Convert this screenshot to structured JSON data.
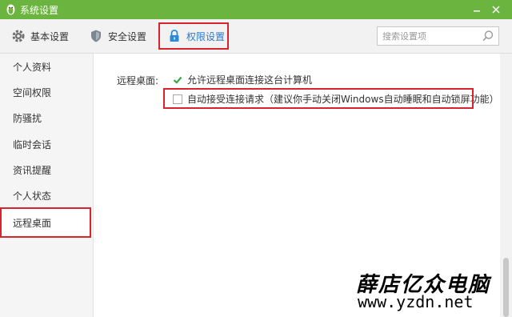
{
  "window": {
    "title": "系统设置",
    "accent_color": "#6ab43f"
  },
  "tabs": [
    {
      "label": "基本设置",
      "icon": "gear-icon"
    },
    {
      "label": "安全设置",
      "icon": "shield-icon"
    },
    {
      "label": "权限设置",
      "icon": "lock-icon",
      "selected": true
    }
  ],
  "search": {
    "placeholder": "搜索设置项",
    "value": ""
  },
  "sidebar": {
    "items": [
      {
        "label": "个人资料"
      },
      {
        "label": "空间权限"
      },
      {
        "label": "防骚扰"
      },
      {
        "label": "临时会话"
      },
      {
        "label": "资讯提醒"
      },
      {
        "label": "个人状态"
      },
      {
        "label": "远程桌面",
        "active": true
      }
    ]
  },
  "main": {
    "section_label": "远程桌面:",
    "options": [
      {
        "label": "允许远程桌面连接这台计算机",
        "checked": true
      },
      {
        "label": "自动接受连接请求（建议你手动关闭Windows自动睡眠和自动锁屏功能）",
        "checked": false
      }
    ]
  },
  "watermark": {
    "line1": "薛店亿众电脑",
    "line2": "www.yzdn.net"
  },
  "highlight_color": "#d8252d"
}
